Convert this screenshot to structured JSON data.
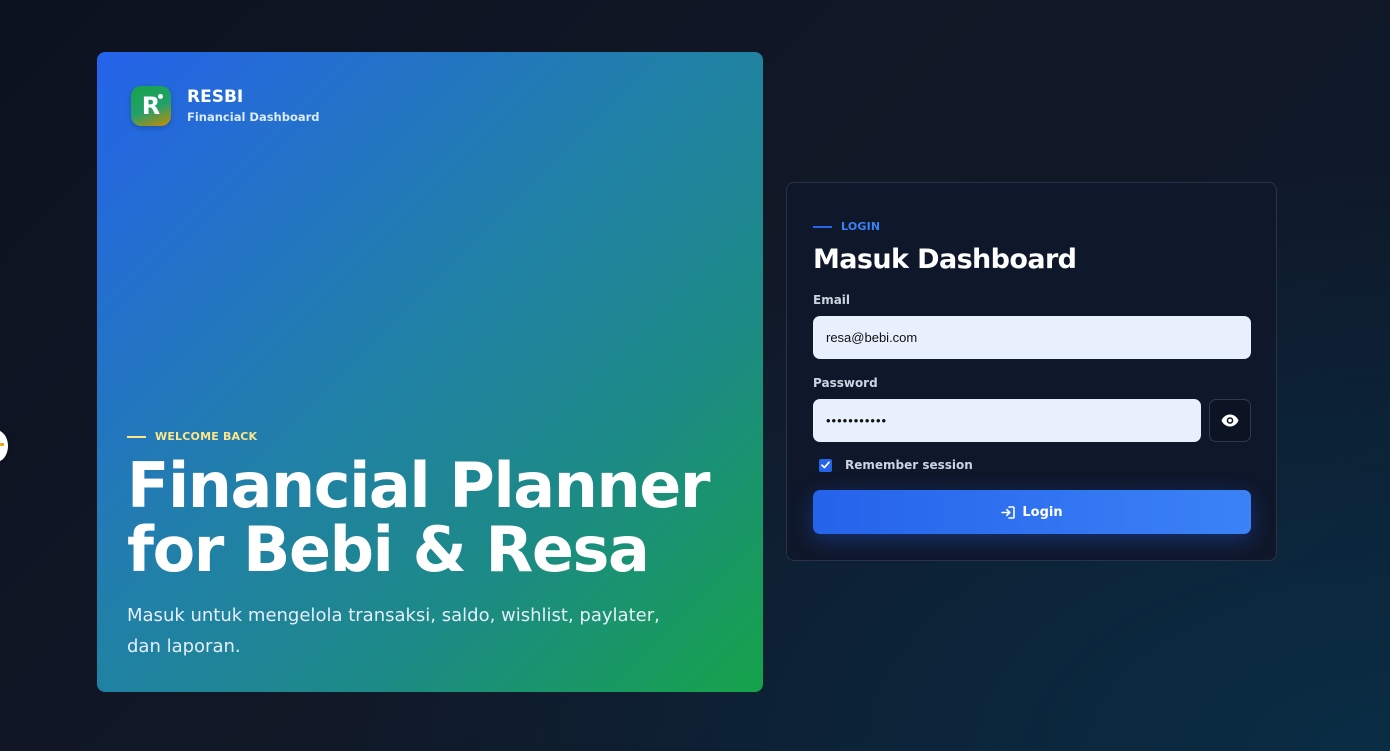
{
  "brand": {
    "logo_letter": "R",
    "name": "RESBI",
    "subtitle": "Financial Dashboard"
  },
  "hero": {
    "eyebrow": "WELCOME BACK",
    "headline_line1": "Financial Planner",
    "headline_line2": "for Bebi & Resa",
    "description": "Masuk untuk mengelola transaksi, saldo, wishlist, paylater, dan laporan."
  },
  "login": {
    "eyebrow": "LOGIN",
    "title": "Masuk Dashboard",
    "email_label": "Email",
    "email_value": "resa@bebi.com",
    "password_label": "Password",
    "password_value": "•••••••••••",
    "remember_label": "Remember session",
    "remember_checked": true,
    "submit_label": "Login",
    "toggle_password_icon": "eye-icon",
    "submit_icon": "login-icon"
  },
  "colors": {
    "accent": "#2563eb",
    "hero_gradient_start": "#2563eb",
    "hero_gradient_end": "#16a34a",
    "eyebrow_hero": "#fde68a",
    "card_bg": "#0f172a",
    "input_bg": "#e8effd"
  }
}
